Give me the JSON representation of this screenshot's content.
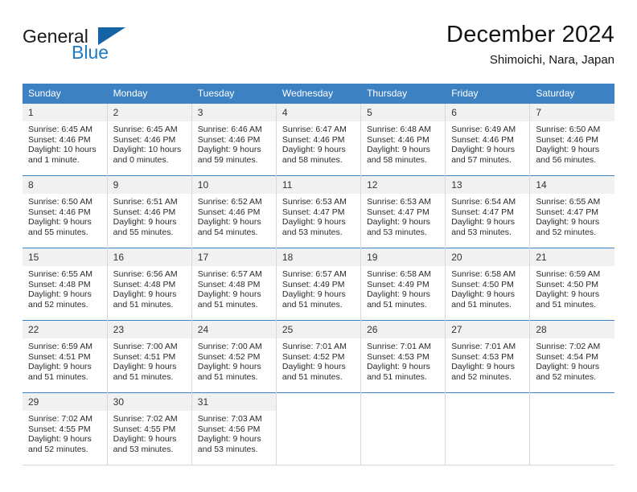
{
  "brand": {
    "name_part1": "General",
    "name_part2": "Blue"
  },
  "header": {
    "title": "December 2024",
    "subtitle": "Shimoichi, Nara, Japan"
  },
  "colors": {
    "header_blue": "#3c81c1",
    "logo_blue": "#1f7ac0",
    "daynum_background": "#f1f1f1",
    "grid_line": "#d8d8d8"
  },
  "weekdays": [
    "Sunday",
    "Monday",
    "Tuesday",
    "Wednesday",
    "Thursday",
    "Friday",
    "Saturday"
  ],
  "weeks": [
    [
      {
        "day": "1",
        "sunrise": "Sunrise: 6:45 AM",
        "sunset": "Sunset: 4:46 PM",
        "daylight1": "Daylight: 10 hours",
        "daylight2": "and 1 minute."
      },
      {
        "day": "2",
        "sunrise": "Sunrise: 6:45 AM",
        "sunset": "Sunset: 4:46 PM",
        "daylight1": "Daylight: 10 hours",
        "daylight2": "and 0 minutes."
      },
      {
        "day": "3",
        "sunrise": "Sunrise: 6:46 AM",
        "sunset": "Sunset: 4:46 PM",
        "daylight1": "Daylight: 9 hours",
        "daylight2": "and 59 minutes."
      },
      {
        "day": "4",
        "sunrise": "Sunrise: 6:47 AM",
        "sunset": "Sunset: 4:46 PM",
        "daylight1": "Daylight: 9 hours",
        "daylight2": "and 58 minutes."
      },
      {
        "day": "5",
        "sunrise": "Sunrise: 6:48 AM",
        "sunset": "Sunset: 4:46 PM",
        "daylight1": "Daylight: 9 hours",
        "daylight2": "and 58 minutes."
      },
      {
        "day": "6",
        "sunrise": "Sunrise: 6:49 AM",
        "sunset": "Sunset: 4:46 PM",
        "daylight1": "Daylight: 9 hours",
        "daylight2": "and 57 minutes."
      },
      {
        "day": "7",
        "sunrise": "Sunrise: 6:50 AM",
        "sunset": "Sunset: 4:46 PM",
        "daylight1": "Daylight: 9 hours",
        "daylight2": "and 56 minutes."
      }
    ],
    [
      {
        "day": "8",
        "sunrise": "Sunrise: 6:50 AM",
        "sunset": "Sunset: 4:46 PM",
        "daylight1": "Daylight: 9 hours",
        "daylight2": "and 55 minutes."
      },
      {
        "day": "9",
        "sunrise": "Sunrise: 6:51 AM",
        "sunset": "Sunset: 4:46 PM",
        "daylight1": "Daylight: 9 hours",
        "daylight2": "and 55 minutes."
      },
      {
        "day": "10",
        "sunrise": "Sunrise: 6:52 AM",
        "sunset": "Sunset: 4:46 PM",
        "daylight1": "Daylight: 9 hours",
        "daylight2": "and 54 minutes."
      },
      {
        "day": "11",
        "sunrise": "Sunrise: 6:53 AM",
        "sunset": "Sunset: 4:47 PM",
        "daylight1": "Daylight: 9 hours",
        "daylight2": "and 53 minutes."
      },
      {
        "day": "12",
        "sunrise": "Sunrise: 6:53 AM",
        "sunset": "Sunset: 4:47 PM",
        "daylight1": "Daylight: 9 hours",
        "daylight2": "and 53 minutes."
      },
      {
        "day": "13",
        "sunrise": "Sunrise: 6:54 AM",
        "sunset": "Sunset: 4:47 PM",
        "daylight1": "Daylight: 9 hours",
        "daylight2": "and 53 minutes."
      },
      {
        "day": "14",
        "sunrise": "Sunrise: 6:55 AM",
        "sunset": "Sunset: 4:47 PM",
        "daylight1": "Daylight: 9 hours",
        "daylight2": "and 52 minutes."
      }
    ],
    [
      {
        "day": "15",
        "sunrise": "Sunrise: 6:55 AM",
        "sunset": "Sunset: 4:48 PM",
        "daylight1": "Daylight: 9 hours",
        "daylight2": "and 52 minutes."
      },
      {
        "day": "16",
        "sunrise": "Sunrise: 6:56 AM",
        "sunset": "Sunset: 4:48 PM",
        "daylight1": "Daylight: 9 hours",
        "daylight2": "and 51 minutes."
      },
      {
        "day": "17",
        "sunrise": "Sunrise: 6:57 AM",
        "sunset": "Sunset: 4:48 PM",
        "daylight1": "Daylight: 9 hours",
        "daylight2": "and 51 minutes."
      },
      {
        "day": "18",
        "sunrise": "Sunrise: 6:57 AM",
        "sunset": "Sunset: 4:49 PM",
        "daylight1": "Daylight: 9 hours",
        "daylight2": "and 51 minutes."
      },
      {
        "day": "19",
        "sunrise": "Sunrise: 6:58 AM",
        "sunset": "Sunset: 4:49 PM",
        "daylight1": "Daylight: 9 hours",
        "daylight2": "and 51 minutes."
      },
      {
        "day": "20",
        "sunrise": "Sunrise: 6:58 AM",
        "sunset": "Sunset: 4:50 PM",
        "daylight1": "Daylight: 9 hours",
        "daylight2": "and 51 minutes."
      },
      {
        "day": "21",
        "sunrise": "Sunrise: 6:59 AM",
        "sunset": "Sunset: 4:50 PM",
        "daylight1": "Daylight: 9 hours",
        "daylight2": "and 51 minutes."
      }
    ],
    [
      {
        "day": "22",
        "sunrise": "Sunrise: 6:59 AM",
        "sunset": "Sunset: 4:51 PM",
        "daylight1": "Daylight: 9 hours",
        "daylight2": "and 51 minutes."
      },
      {
        "day": "23",
        "sunrise": "Sunrise: 7:00 AM",
        "sunset": "Sunset: 4:51 PM",
        "daylight1": "Daylight: 9 hours",
        "daylight2": "and 51 minutes."
      },
      {
        "day": "24",
        "sunrise": "Sunrise: 7:00 AM",
        "sunset": "Sunset: 4:52 PM",
        "daylight1": "Daylight: 9 hours",
        "daylight2": "and 51 minutes."
      },
      {
        "day": "25",
        "sunrise": "Sunrise: 7:01 AM",
        "sunset": "Sunset: 4:52 PM",
        "daylight1": "Daylight: 9 hours",
        "daylight2": "and 51 minutes."
      },
      {
        "day": "26",
        "sunrise": "Sunrise: 7:01 AM",
        "sunset": "Sunset: 4:53 PM",
        "daylight1": "Daylight: 9 hours",
        "daylight2": "and 51 minutes."
      },
      {
        "day": "27",
        "sunrise": "Sunrise: 7:01 AM",
        "sunset": "Sunset: 4:53 PM",
        "daylight1": "Daylight: 9 hours",
        "daylight2": "and 52 minutes."
      },
      {
        "day": "28",
        "sunrise": "Sunrise: 7:02 AM",
        "sunset": "Sunset: 4:54 PM",
        "daylight1": "Daylight: 9 hours",
        "daylight2": "and 52 minutes."
      }
    ],
    [
      {
        "day": "29",
        "sunrise": "Sunrise: 7:02 AM",
        "sunset": "Sunset: 4:55 PM",
        "daylight1": "Daylight: 9 hours",
        "daylight2": "and 52 minutes."
      },
      {
        "day": "30",
        "sunrise": "Sunrise: 7:02 AM",
        "sunset": "Sunset: 4:55 PM",
        "daylight1": "Daylight: 9 hours",
        "daylight2": "and 53 minutes."
      },
      {
        "day": "31",
        "sunrise": "Sunrise: 7:03 AM",
        "sunset": "Sunset: 4:56 PM",
        "daylight1": "Daylight: 9 hours",
        "daylight2": "and 53 minutes."
      },
      {
        "day": "",
        "sunrise": "",
        "sunset": "",
        "daylight1": "",
        "daylight2": ""
      },
      {
        "day": "",
        "sunrise": "",
        "sunset": "",
        "daylight1": "",
        "daylight2": ""
      },
      {
        "day": "",
        "sunrise": "",
        "sunset": "",
        "daylight1": "",
        "daylight2": ""
      },
      {
        "day": "",
        "sunrise": "",
        "sunset": "",
        "daylight1": "",
        "daylight2": ""
      }
    ]
  ]
}
